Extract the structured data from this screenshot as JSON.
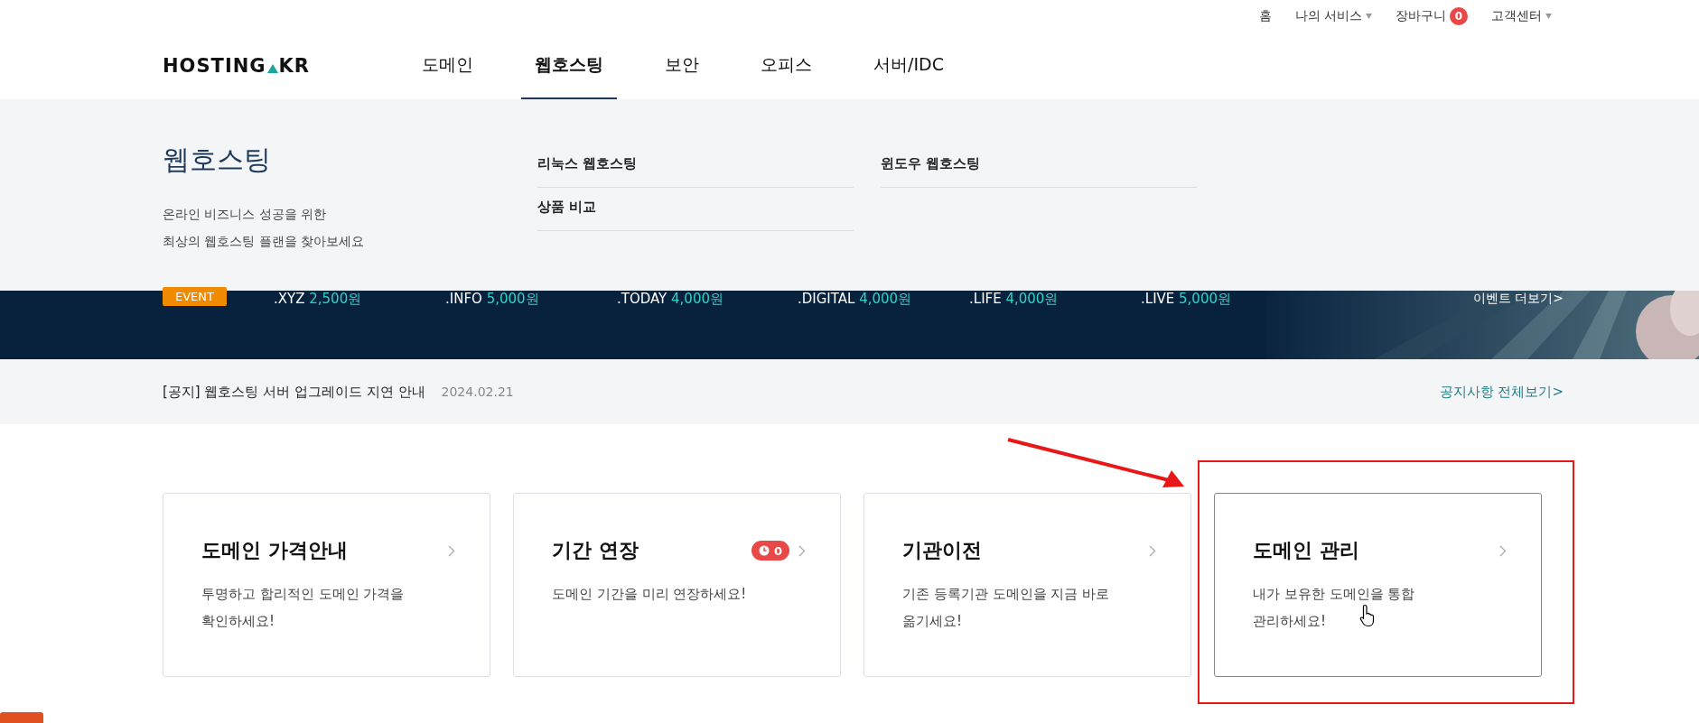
{
  "utility_menu": [
    {
      "label": "홈",
      "dropdown": false
    },
    {
      "label": "나의 서비스",
      "dropdown": true
    },
    {
      "label": "장바구니",
      "dropdown": false,
      "badge": "0"
    },
    {
      "label": "고객센터",
      "dropdown": true
    }
  ],
  "logo": {
    "left": "HOSTING",
    "right": "KR"
  },
  "nav": [
    {
      "label": "도메인",
      "selected": false
    },
    {
      "label": "웹호스팅",
      "selected": true
    },
    {
      "label": "보안",
      "selected": false
    },
    {
      "label": "오피스",
      "selected": false
    },
    {
      "label": "서버/IDC",
      "selected": false
    }
  ],
  "mega_menu": {
    "title": "웹호스팅",
    "description": [
      "온라인 비즈니스 성공을 위한",
      "최상의 웹호스팅 플랜을 찾아보세요"
    ],
    "links": [
      "리눅스 웹호스팅",
      "윈도우 웹호스팅",
      "상품 비교"
    ]
  },
  "banner": {
    "badge": "EVENT",
    "prices": [
      {
        "tld": ".XYZ",
        "price": "2,500원"
      },
      {
        "tld": ".INFO",
        "price": "5,000원"
      },
      {
        "tld": ".TODAY",
        "price": "4,000원"
      },
      {
        "tld": ".DIGITAL",
        "price": "4,000원"
      },
      {
        "tld": ".LIFE",
        "price": "4,000원"
      },
      {
        "tld": ".LIVE",
        "price": "5,000원"
      }
    ],
    "more": "이벤트 더보기>"
  },
  "notice": {
    "text": "[공지] 웹호스팅 서버 업그레이드 지연 안내",
    "date": "2024.02.21",
    "link": "공지사항 전체보기>"
  },
  "cards": [
    {
      "title": "도메인 가격안내",
      "description": [
        "투명하고 합리적인 도메인 가격을",
        "확인하세요!"
      ],
      "highlighted": false
    },
    {
      "title": "기간 연장",
      "badge": "0",
      "description": [
        "도메인 기간을 미리 연장하세요!"
      ],
      "highlighted": false
    },
    {
      "title": "기관이전",
      "description": [
        "기존 등록기관 도메인을 지금 바로",
        "옮기세요!"
      ],
      "highlighted": false
    },
    {
      "title": "도메인 관리",
      "description": [
        "내가 보유한 도메인을 통합",
        "관리하세요!"
      ],
      "highlighted": true
    }
  ]
}
